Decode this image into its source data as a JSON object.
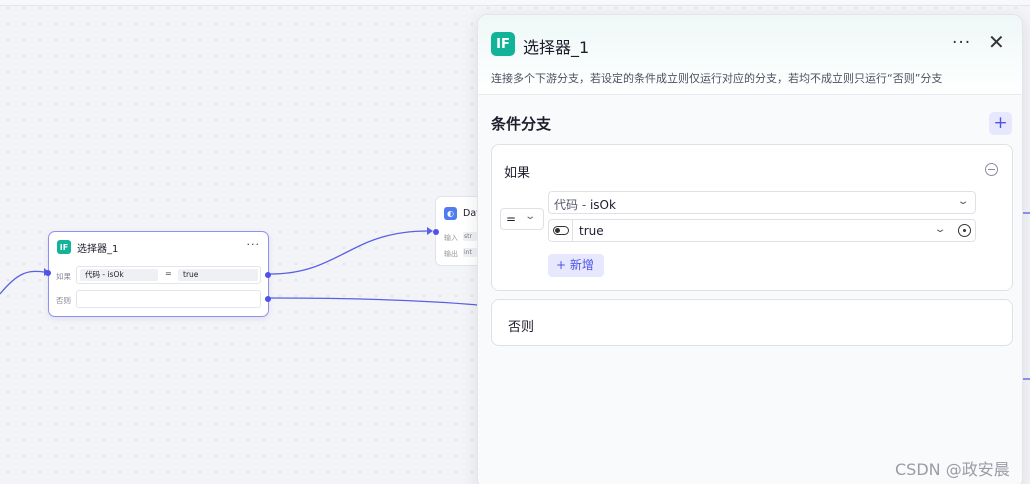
{
  "canvas": {
    "selector_node": {
      "badge": "IF",
      "title": "选择器_1",
      "more": "···",
      "if_label": "如果",
      "var_label": "代码 - isOk",
      "operator": "=",
      "value": "true",
      "else_label": "否则"
    },
    "second_node": {
      "title": "Day",
      "input_label": "输入",
      "input_chip": "str",
      "output_label": "输出",
      "output_chip": "int"
    }
  },
  "panel": {
    "badge": "IF",
    "title": "选择器_1",
    "more": "···",
    "close": "✕",
    "description": "连接多个下游分支，若设定的条件成立则仅运行对应的分支，若均不成立则只运行“否则”分支",
    "section_title": "条件分支",
    "add": "+",
    "branch": {
      "label": "如果",
      "operator": "=",
      "variable_prefix": "代码 - ",
      "variable_name": "isOk",
      "value": "true",
      "add_condition": "+ 新增"
    },
    "else": {
      "label": "否则"
    }
  },
  "watermark": "CSDN @政安晨",
  "colors": {
    "accent": "#4d53e8",
    "if_badge": "#13b39a",
    "edge": "#5960e6"
  }
}
